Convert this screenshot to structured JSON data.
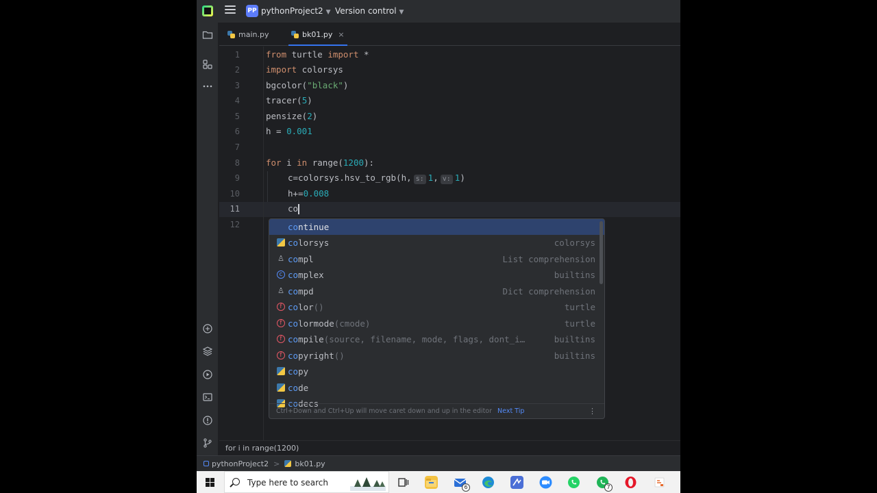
{
  "titlebar": {
    "project_badge": "PP",
    "project_name": "pythonProject2",
    "version_control": "Version control"
  },
  "tabs": [
    {
      "label": "main.py",
      "active": false
    },
    {
      "label": "bk01.py",
      "active": true,
      "close": "×"
    }
  ],
  "editor": {
    "line_numbers": [
      "1",
      "2",
      "3",
      "4",
      "5",
      "6",
      "7",
      "8",
      "9",
      "10",
      "11",
      "12"
    ],
    "current_line": 11,
    "lines": {
      "l1": {
        "kw1": "from",
        "t1": " turtle ",
        "kw2": "import",
        "t2": " *"
      },
      "l2": {
        "kw1": "import",
        "t1": " colorsys"
      },
      "l3": {
        "t1": "bgcolor(",
        "s1": "\"black\"",
        "t2": ")"
      },
      "l4": {
        "t1": "tracer(",
        "n1": "5",
        "t2": ")"
      },
      "l5": {
        "t1": "pensize(",
        "n1": "2",
        "t2": ")"
      },
      "l6": {
        "t1": "h = ",
        "n1": "0.001"
      },
      "l8": {
        "kw1": "for",
        "t1": " i ",
        "kw2": "in",
        "t2": " range(",
        "n1": "1200",
        "t3": "):"
      },
      "l9": {
        "t1": "c=colorsys.hsv_to_rgb(h,",
        "h1": "s:",
        "n1": "1",
        "t2": ",",
        "h2": "v:",
        "n2": "1",
        "t3": ")"
      },
      "l10": {
        "t1": "h+=",
        "n1": "0.008"
      },
      "l11": {
        "t1": "co"
      }
    }
  },
  "completion": {
    "items": [
      {
        "match": "co",
        "rest": "ntinue",
        "sig": "",
        "tail": "",
        "icon": "none"
      },
      {
        "match": "co",
        "rest": "lorsys",
        "sig": "",
        "tail": "colorsys",
        "icon": "python"
      },
      {
        "match": "co",
        "rest": "mpl",
        "sig": "",
        "tail": "List comprehension",
        "icon": "template"
      },
      {
        "match": "co",
        "rest": "mplex",
        "sig": "",
        "tail": "builtins",
        "icon": "class"
      },
      {
        "match": "co",
        "rest": "mpd",
        "sig": "",
        "tail": "Dict comprehension",
        "icon": "template"
      },
      {
        "match": "co",
        "rest": "lor",
        "sig": "()",
        "tail": "turtle",
        "icon": "function"
      },
      {
        "match": "co",
        "rest": "lormode",
        "sig": "(cmode)",
        "tail": "turtle",
        "icon": "function"
      },
      {
        "match": "co",
        "rest": "mpile",
        "sig": "(source, filename, mode, flags, dont_i…",
        "tail": "builtins",
        "icon": "function"
      },
      {
        "match": "co",
        "rest": "pyright",
        "sig": "()",
        "tail": "builtins",
        "icon": "function"
      },
      {
        "match": "co",
        "rest": "py",
        "sig": "",
        "tail": "",
        "icon": "python"
      },
      {
        "match": "co",
        "rest": "de",
        "sig": "",
        "tail": "",
        "icon": "python"
      },
      {
        "match": "co",
        "rest": "decs",
        "sig": "",
        "tail": "",
        "icon": "python"
      }
    ],
    "footer_tip": "Ctrl+Down and Ctrl+Up will move caret down and up in the editor",
    "next_tip": "Next Tip",
    "menu": "⋮"
  },
  "breadcrumb": "for i in range(1200)",
  "statusbar": {
    "project": "pythonProject2",
    "separator": ">",
    "file": "bk01.py"
  },
  "taskbar": {
    "search_placeholder": "Type here to search",
    "mail_badge": "6",
    "whatsapp_badge": "7"
  },
  "colors": {
    "keyword": "#cf8e6d",
    "number": "#2aacb8",
    "string": "#6aab73",
    "match_highlight": "#5e9cf6",
    "selection": "#2e436e"
  }
}
